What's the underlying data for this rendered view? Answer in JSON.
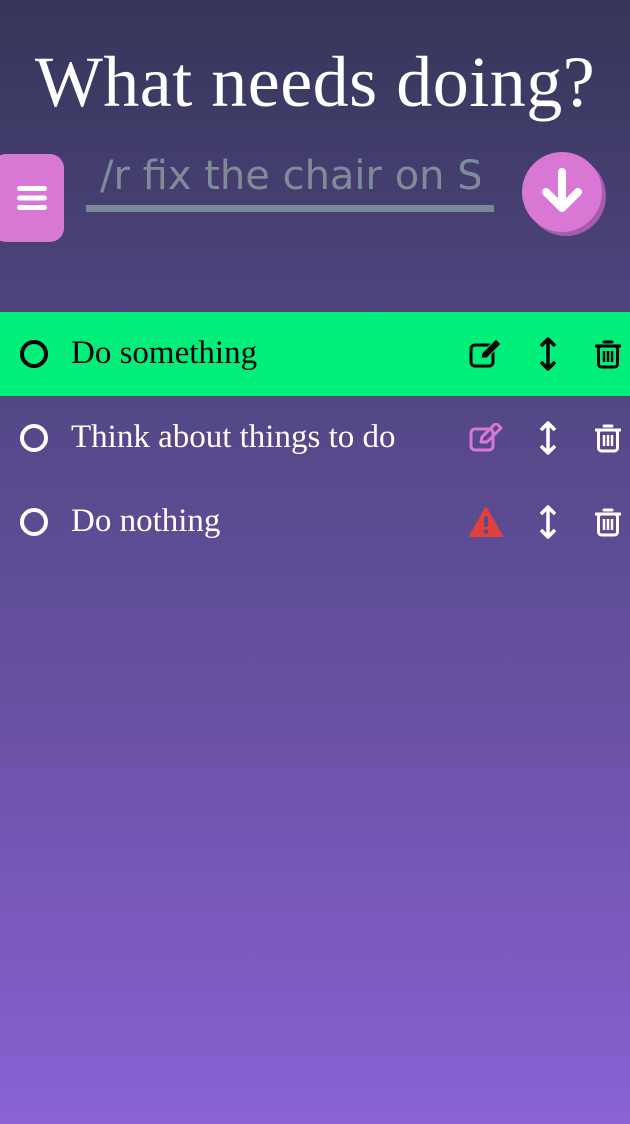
{
  "header": {
    "title": "What needs doing?"
  },
  "menu": {
    "icon": "hamburger-icon"
  },
  "new_task": {
    "placeholder": "/r fix the chair on S",
    "value": ""
  },
  "submit": {
    "icon": "arrow-down-icon"
  },
  "colors": {
    "accent": "#d977d5",
    "active_row": "#00ef7a",
    "warning": "#e0413f",
    "input_underline": "#7a8796"
  },
  "todos": [
    {
      "text": "Do something",
      "active": true,
      "status_icon": "edit-icon"
    },
    {
      "text": "Think about things to do",
      "active": false,
      "status_icon": "edit-icon"
    },
    {
      "text": "Do nothing",
      "active": false,
      "status_icon": "warning-icon"
    }
  ]
}
